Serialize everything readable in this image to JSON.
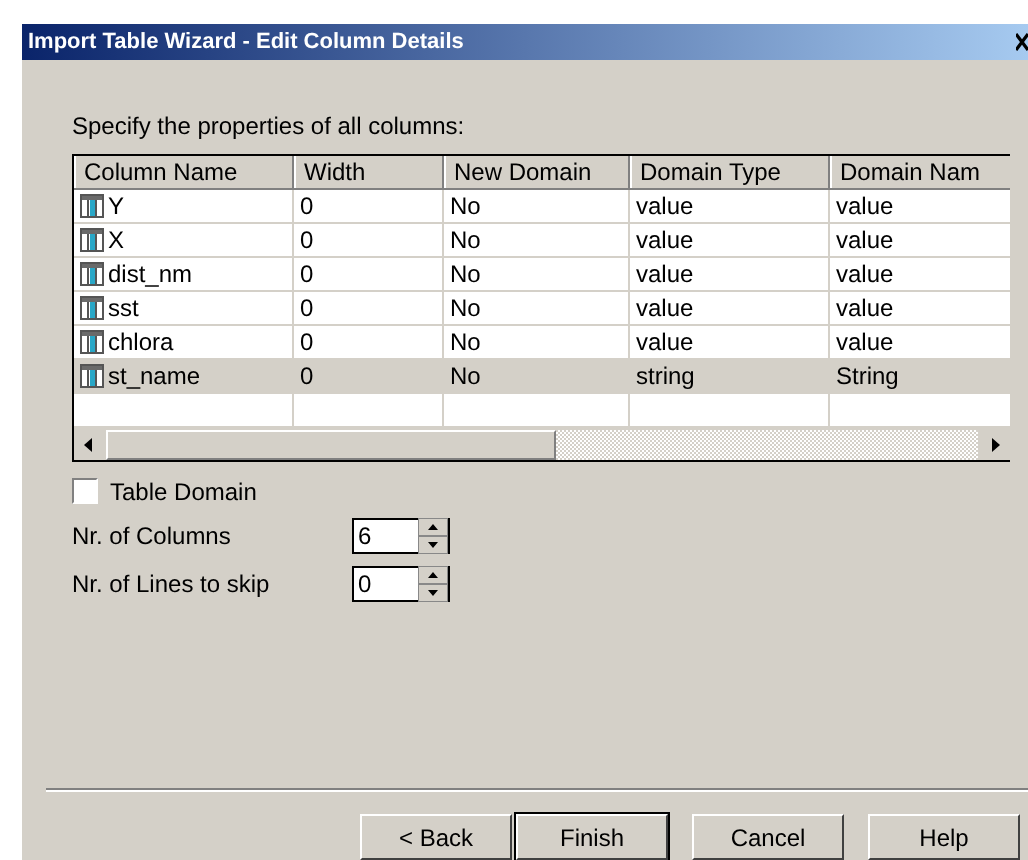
{
  "window": {
    "title": "Import Table Wizard - Edit Column Details"
  },
  "instruction": "Specify the properties of all columns:",
  "table": {
    "columns": [
      "Column Name",
      "Width",
      "New Domain",
      "Domain Type",
      "Domain Nam"
    ],
    "rows": [
      {
        "cells": [
          "Y",
          "0",
          "No",
          "value",
          "value"
        ],
        "selected": false
      },
      {
        "cells": [
          "X",
          "0",
          "No",
          "value",
          "value"
        ],
        "selected": false
      },
      {
        "cells": [
          "dist_nm",
          "0",
          "No",
          "value",
          "value"
        ],
        "selected": false
      },
      {
        "cells": [
          "sst",
          "0",
          "No",
          "value",
          "value"
        ],
        "selected": false
      },
      {
        "cells": [
          "chlora",
          "0",
          "No",
          "value",
          "value"
        ],
        "selected": false
      },
      {
        "cells": [
          "st_name",
          "0",
          "No",
          "string",
          "String"
        ],
        "selected": true
      }
    ]
  },
  "table_domain": {
    "label": "Table Domain",
    "checked": false
  },
  "spinners": [
    {
      "label": "Nr. of Columns",
      "value": "6"
    },
    {
      "label": "Nr. of Lines to skip",
      "value": "0"
    }
  ],
  "buttons": [
    {
      "label": "< Back",
      "default": false
    },
    {
      "label": "Finish",
      "default": true
    },
    {
      "label": "Cancel",
      "default": false
    },
    {
      "label": "Help",
      "default": false
    }
  ]
}
